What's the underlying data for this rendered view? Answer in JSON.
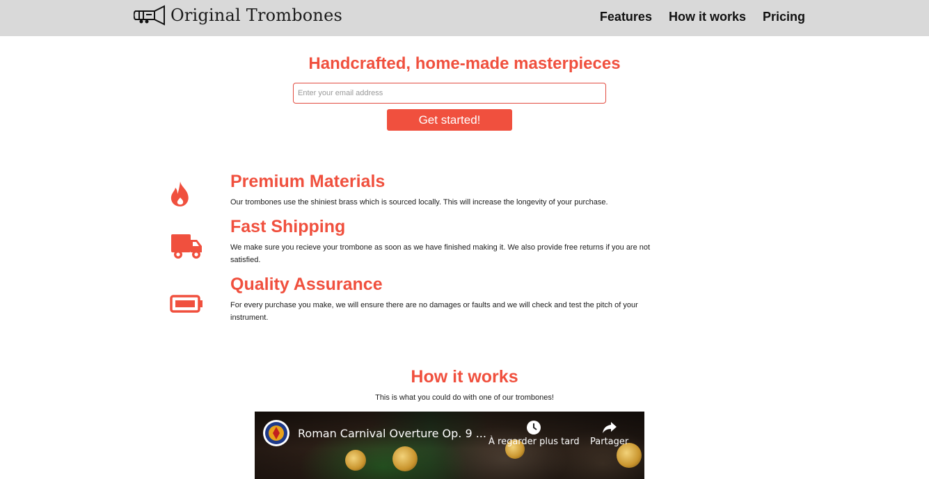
{
  "header": {
    "brand": "Original Trombones",
    "nav": [
      "Features",
      "How it works",
      "Pricing"
    ]
  },
  "hero": {
    "title": "Handcrafted, home-made masterpieces",
    "email_placeholder": "Enter your email address",
    "cta_label": "Get started!"
  },
  "features": [
    {
      "icon": "fire-icon",
      "title": "Premium Materials",
      "description": "Our trombones use the shiniest brass which is sourced locally. This will increase the longevity of your purchase."
    },
    {
      "icon": "truck-icon",
      "title": "Fast Shipping",
      "description": "We make sure you recieve your trombone as soon as we have finished making it. We also provide free returns if you are not satisfied."
    },
    {
      "icon": "battery-icon",
      "title": "Quality Assurance",
      "description": "For every purchase you make, we will ensure there are no damages or faults and we will check and test the pitch of your instrument."
    }
  ],
  "how": {
    "title": "How it works",
    "subtitle": "This is what you could do with one of our trombones!"
  },
  "video": {
    "title": "Roman Carnival Overture Op. 9 ...",
    "watch_later": "À regarder plus tard",
    "share": "Partager"
  },
  "colors": {
    "accent": "#f0503e",
    "header_bg": "#d9d9d9"
  }
}
